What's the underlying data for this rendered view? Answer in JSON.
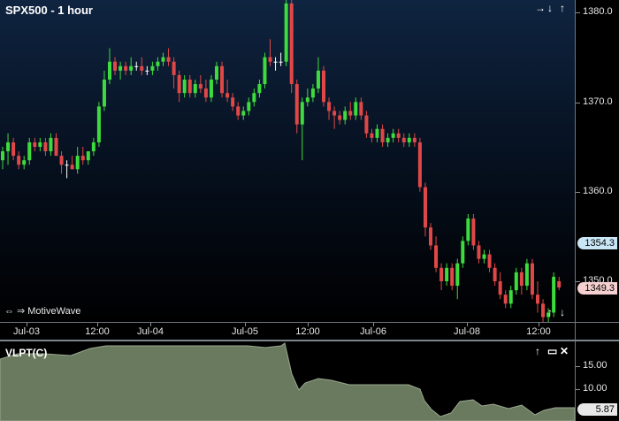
{
  "chart": {
    "title": "SPX500 - 1 hour",
    "brand": "MotiveWave",
    "price_labels": [
      "1380.0",
      "1370.0",
      "1360.0",
      "1350.0"
    ],
    "last_price_tag": "1354.3",
    "bid_price_tag": "1349.3",
    "time_labels": [
      "Jul-03",
      "12:00",
      "Jul-04",
      "Jul-05",
      "12:00",
      "Jul-06",
      "Jul-08",
      "12:00"
    ],
    "controls": {
      "pan_right": "→",
      "move_down": "↓",
      "move_up": "↑"
    },
    "bottom_controls": {
      "move_up": "↑",
      "move_down": "↓"
    },
    "brand_icons": {
      "pan_left": "⇔",
      "pan_right": "⇒"
    }
  },
  "indicator": {
    "title": "VLPT(C)",
    "labels": [
      "15.00",
      "10.00"
    ],
    "current_tag": "5.87",
    "controls": {
      "move_up": "↑",
      "maximize": "▭",
      "close": "✕"
    }
  },
  "colors": {
    "up_candle": "#3ddb3d",
    "down_candle": "#e04848",
    "doji": "#ffffff",
    "area_fill": "#6a7a5f",
    "last_tag_bg": "#c9e6f7",
    "bid_tag_bg": "#f6d0d0",
    "ind_tag_bg": "#e8e8e8"
  },
  "chart_data": {
    "type": "candlestick",
    "symbol": "SPX500",
    "interval": "1 hour",
    "y_range": [
      1344,
      1384
    ],
    "ohlc": [
      [
        1363.5,
        1365.0,
        1362.5,
        1364.5
      ],
      [
        1364.5,
        1366.5,
        1363.0,
        1365.5
      ],
      [
        1365.5,
        1366.0,
        1363.5,
        1364.0
      ],
      [
        1364.0,
        1364.5,
        1362.5,
        1363.0
      ],
      [
        1363.0,
        1364.0,
        1362.5,
        1363.5
      ],
      [
        1363.5,
        1366.0,
        1363.0,
        1365.5
      ],
      [
        1365.5,
        1366.0,
        1364.5,
        1365.0
      ],
      [
        1365.0,
        1366.0,
        1364.5,
        1365.5
      ],
      [
        1365.5,
        1366.0,
        1364.0,
        1364.5
      ],
      [
        1364.5,
        1366.5,
        1364.0,
        1366.0
      ],
      [
        1366.0,
        1366.5,
        1364.0,
        1364.0
      ],
      [
        1364.0,
        1364.5,
        1362.0,
        1363.0
      ],
      [
        1363.0,
        1363.5,
        1361.5,
        1363.0
      ],
      [
        1363.0,
        1364.0,
        1362.5,
        1362.5
      ],
      [
        1362.5,
        1365.0,
        1362.0,
        1364.0
      ],
      [
        1364.0,
        1365.0,
        1363.0,
        1363.5
      ],
      [
        1363.5,
        1364.5,
        1363.0,
        1364.5
      ],
      [
        1364.5,
        1366.0,
        1364.0,
        1365.5
      ],
      [
        1365.5,
        1370.0,
        1365.0,
        1369.5
      ],
      [
        1369.5,
        1373.5,
        1369.0,
        1372.5
      ],
      [
        1372.5,
        1376.0,
        1372.0,
        1374.5
      ],
      [
        1374.5,
        1375.0,
        1373.0,
        1373.5
      ],
      [
        1373.5,
        1374.5,
        1372.5,
        1374.0
      ],
      [
        1374.0,
        1374.5,
        1373.0,
        1373.5
      ],
      [
        1373.5,
        1375.0,
        1373.0,
        1374.0
      ],
      [
        1374.0,
        1374.5,
        1373.5,
        1374.0
      ],
      [
        1374.0,
        1375.0,
        1373.0,
        1373.5
      ],
      [
        1373.5,
        1374.0,
        1373.0,
        1373.5
      ],
      [
        1373.5,
        1374.5,
        1373.0,
        1374.0
      ],
      [
        1374.0,
        1375.0,
        1373.5,
        1374.5
      ],
      [
        1374.5,
        1375.5,
        1374.0,
        1375.0
      ],
      [
        1375.0,
        1376.0,
        1374.0,
        1374.5
      ],
      [
        1374.5,
        1375.0,
        1371.5,
        1373.0
      ],
      [
        1373.0,
        1373.5,
        1370.0,
        1371.0
      ],
      [
        1371.0,
        1373.0,
        1370.5,
        1372.5
      ],
      [
        1372.5,
        1373.0,
        1370.5,
        1371.0
      ],
      [
        1371.0,
        1372.5,
        1370.5,
        1372.0
      ],
      [
        1372.0,
        1373.0,
        1371.0,
        1371.5
      ],
      [
        1371.5,
        1372.5,
        1370.0,
        1370.5
      ],
      [
        1370.5,
        1373.0,
        1370.0,
        1372.5
      ],
      [
        1372.5,
        1374.5,
        1372.0,
        1374.0
      ],
      [
        1374.0,
        1374.5,
        1370.5,
        1371.0
      ],
      [
        1371.0,
        1372.5,
        1370.0,
        1370.5
      ],
      [
        1370.5,
        1371.0,
        1369.0,
        1369.5
      ],
      [
        1369.5,
        1370.0,
        1368.0,
        1368.5
      ],
      [
        1368.5,
        1369.5,
        1368.0,
        1369.0
      ],
      [
        1369.0,
        1370.5,
        1368.5,
        1370.0
      ],
      [
        1370.0,
        1371.5,
        1369.5,
        1371.0
      ],
      [
        1371.0,
        1372.5,
        1370.5,
        1372.0
      ],
      [
        1372.0,
        1375.5,
        1371.5,
        1375.0
      ],
      [
        1375.0,
        1377.0,
        1374.0,
        1374.5
      ],
      [
        1374.5,
        1375.0,
        1373.5,
        1374.5
      ],
      [
        1374.5,
        1375.5,
        1374.0,
        1374.5
      ],
      [
        1374.5,
        1382.0,
        1374.0,
        1381.0
      ],
      [
        1381.0,
        1383.0,
        1371.0,
        1372.0
      ],
      [
        1372.0,
        1372.5,
        1366.5,
        1367.5
      ],
      [
        1367.5,
        1370.5,
        1363.5,
        1370.0
      ],
      [
        1370.0,
        1371.5,
        1369.5,
        1370.5
      ],
      [
        1370.5,
        1372.0,
        1370.0,
        1371.5
      ],
      [
        1371.5,
        1375.0,
        1371.0,
        1373.5
      ],
      [
        1373.5,
        1374.0,
        1369.5,
        1370.0
      ],
      [
        1370.0,
        1370.5,
        1368.0,
        1369.0
      ],
      [
        1369.0,
        1369.5,
        1367.0,
        1368.5
      ],
      [
        1368.5,
        1369.0,
        1367.5,
        1368.0
      ],
      [
        1368.0,
        1369.5,
        1367.5,
        1369.0
      ],
      [
        1369.0,
        1370.0,
        1368.0,
        1368.5
      ],
      [
        1368.5,
        1370.5,
        1368.0,
        1370.0
      ],
      [
        1370.0,
        1370.5,
        1368.0,
        1368.5
      ],
      [
        1368.5,
        1369.0,
        1366.0,
        1366.5
      ],
      [
        1366.5,
        1367.0,
        1365.5,
        1366.0
      ],
      [
        1366.0,
        1367.5,
        1365.5,
        1367.0
      ],
      [
        1367.0,
        1367.5,
        1365.0,
        1365.5
      ],
      [
        1365.5,
        1366.5,
        1365.0,
        1366.0
      ],
      [
        1366.0,
        1367.0,
        1365.5,
        1366.5
      ],
      [
        1366.5,
        1367.0,
        1365.5,
        1366.0
      ],
      [
        1366.0,
        1366.5,
        1365.0,
        1365.5
      ],
      [
        1365.5,
        1366.5,
        1365.0,
        1366.0
      ],
      [
        1366.0,
        1366.5,
        1365.0,
        1365.5
      ],
      [
        1365.5,
        1366.0,
        1360.0,
        1360.5
      ],
      [
        1360.5,
        1361.0,
        1355.0,
        1356.0
      ],
      [
        1356.0,
        1356.5,
        1353.5,
        1354.0
      ],
      [
        1354.0,
        1355.0,
        1351.0,
        1351.5
      ],
      [
        1351.5,
        1352.0,
        1349.0,
        1350.0
      ],
      [
        1350.0,
        1352.0,
        1349.5,
        1351.5
      ],
      [
        1351.5,
        1352.0,
        1349.0,
        1349.5
      ],
      [
        1349.5,
        1352.5,
        1348.0,
        1352.0
      ],
      [
        1352.0,
        1355.0,
        1351.5,
        1354.5
      ],
      [
        1354.5,
        1357.5,
        1354.0,
        1357.0
      ],
      [
        1357.0,
        1357.5,
        1353.5,
        1354.0
      ],
      [
        1354.0,
        1354.5,
        1352.0,
        1352.5
      ],
      [
        1352.5,
        1353.5,
        1352.0,
        1353.0
      ],
      [
        1353.0,
        1353.5,
        1351.0,
        1351.5
      ],
      [
        1351.5,
        1352.0,
        1349.5,
        1350.0
      ],
      [
        1350.0,
        1351.0,
        1348.0,
        1348.5
      ],
      [
        1348.5,
        1349.0,
        1347.0,
        1347.5
      ],
      [
        1347.5,
        1349.5,
        1347.0,
        1349.0
      ],
      [
        1349.0,
        1351.5,
        1348.5,
        1351.0
      ],
      [
        1351.0,
        1351.5,
        1348.5,
        1349.5
      ],
      [
        1349.5,
        1352.5,
        1349.0,
        1352.0
      ],
      [
        1352.0,
        1352.5,
        1348.0,
        1348.5
      ],
      [
        1348.5,
        1350.0,
        1346.5,
        1347.5
      ],
      [
        1347.5,
        1348.0,
        1345.0,
        1346.0
      ],
      [
        1346.0,
        1347.0,
        1345.0,
        1346.5
      ],
      [
        1346.5,
        1351.0,
        1346.0,
        1350.5
      ],
      [
        1350.0,
        1350.5,
        1349.0,
        1349.3
      ]
    ]
  }
}
